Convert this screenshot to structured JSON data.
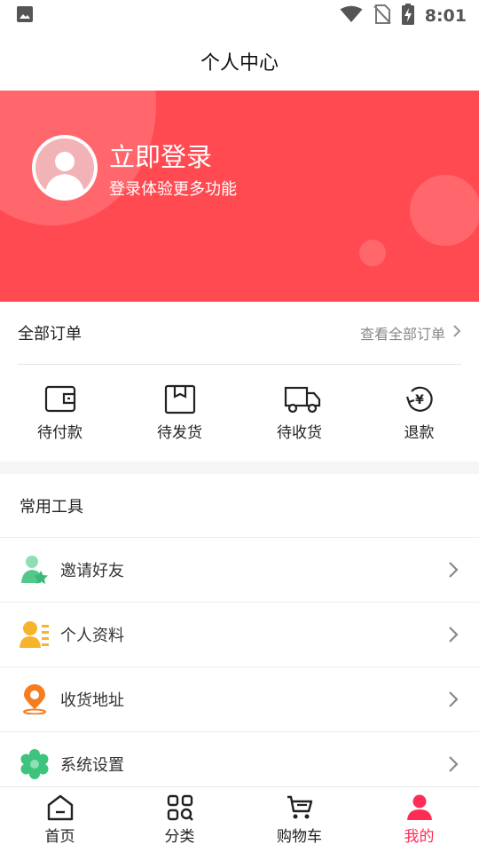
{
  "status_bar": {
    "time": "8:01",
    "icons": [
      "image-icon",
      "wifi-icon",
      "no-sim-icon",
      "battery-charging-icon"
    ]
  },
  "header": {
    "title": "个人中心"
  },
  "profile": {
    "login_title": "立即登录",
    "login_subtitle": "登录体验更多功能",
    "avatar_icon": "default-avatar-icon"
  },
  "orders": {
    "title": "全部订单",
    "view_all": "查看全部订单",
    "items": [
      {
        "label": "待付款",
        "icon": "wallet-icon"
      },
      {
        "label": "待发货",
        "icon": "package-icon"
      },
      {
        "label": "待收货",
        "icon": "truck-icon"
      },
      {
        "label": "退款",
        "icon": "refund-yen-icon"
      }
    ]
  },
  "tools": {
    "title": "常用工具",
    "items": [
      {
        "label": "邀请好友",
        "icon": "invite-friend-icon",
        "color": "#52c98a"
      },
      {
        "label": "个人资料",
        "icon": "profile-card-icon",
        "color": "#f7b32b"
      },
      {
        "label": "收货地址",
        "icon": "location-pin-icon",
        "color": "#f57c1f"
      },
      {
        "label": "系统设置",
        "icon": "settings-gear-icon",
        "color": "#3cc47c"
      }
    ]
  },
  "tab_bar": {
    "active_color": "#ff2d55",
    "items": [
      {
        "label": "首页",
        "icon": "home-icon"
      },
      {
        "label": "分类",
        "icon": "category-icon"
      },
      {
        "label": "购物车",
        "icon": "cart-icon"
      },
      {
        "label": "我的",
        "icon": "user-icon",
        "active": true
      }
    ]
  },
  "colors": {
    "primary": "#ff4a52",
    "text_gray": "#888888"
  }
}
